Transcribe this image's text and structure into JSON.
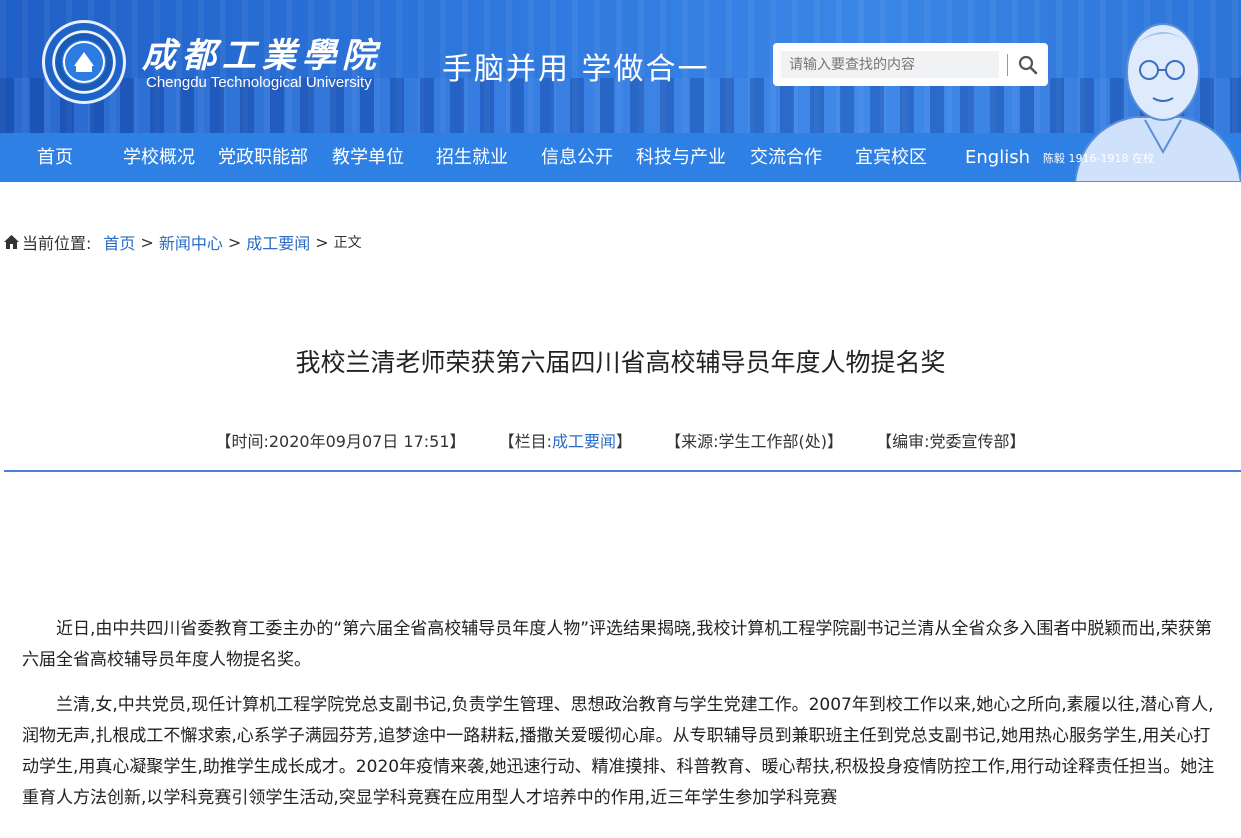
{
  "header": {
    "logo_cn": "成都工業學院",
    "logo_en": "Chengdu Technological University",
    "slogan": "手脑并用  学做合一",
    "search_placeholder": "请输入要查找的内容",
    "portrait_caption": "陈毅 1916-1918 在校"
  },
  "nav": {
    "items": [
      "首页",
      "学校概况",
      "党政职能部",
      "教学单位",
      "招生就业",
      "信息公开",
      "科技与产业",
      "交流合作",
      "宜宾校区",
      "English"
    ]
  },
  "breadcrumb": {
    "label": "当前位置:",
    "links": [
      "首页",
      "新闻中心",
      "成工要闻"
    ],
    "separator": ">",
    "current": "正文"
  },
  "article": {
    "title": "我校兰清老师荣获第六届四川省高校辅导员年度人物提名奖",
    "meta": {
      "time": "【时间:2020年09月07日 17:51】",
      "column_prefix": "【栏目:",
      "column": "成工要闻",
      "column_suffix": "】",
      "source": "【来源:学生工作部(处)】",
      "editor": "【编审:党委宣传部】"
    },
    "paragraphs": [
      "近日,由中共四川省委教育工委主办的“第六届全省高校辅导员年度人物”评选结果揭晓,我校计算机工程学院副书记兰清从全省众多入围者中脱颖而出,荣获第六届全省高校辅导员年度人物提名奖。",
      "兰清,女,中共党员,现任计算机工程学院党总支副书记,负责学生管理、思想政治教育与学生党建工作。2007年到校工作以来,她心之所向,素履以往,潜心育人,润物无声,扎根成工不懈求索,心系学子满园芬芳,追梦途中一路耕耘,播撒关爱暖彻心扉。从专职辅导员到兼职班主任到党总支副书记,她用热心服务学生,用关心打动学生,用真心凝聚学生,助推学生成长成才。2020年疫情来袭,她迅速行动、精准摸排、科普教育、暖心帮扶,积极投身疫情防控工作,用行动诠释责任担当。她注重育人方法创新,以学科竞赛引领学生活动,突显学科竞赛在应用型人才培养中的作用,近三年学生参加学科竞赛"
    ]
  },
  "colors": {
    "header_blue": "#2f78de",
    "nav_blue": "#2f80e4",
    "link_blue": "#2b6cc4",
    "rule_blue": "#4a7fd8"
  }
}
